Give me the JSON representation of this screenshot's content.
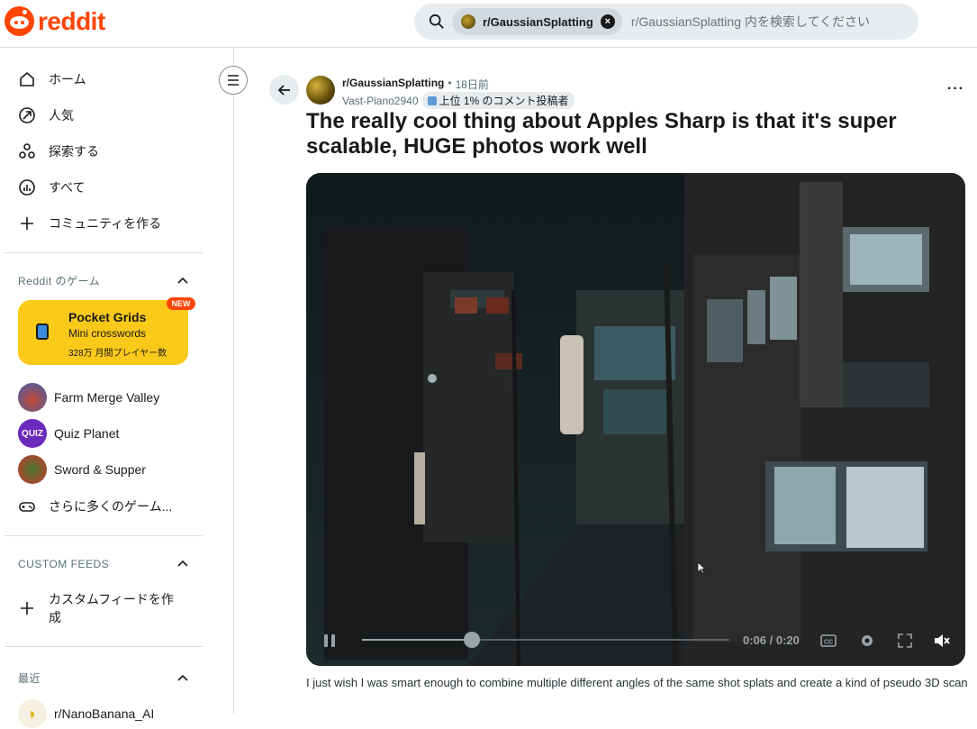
{
  "header": {
    "logo_text": "reddit",
    "search": {
      "chip_label": "r/GaussianSplatting",
      "placeholder": "r/GaussianSplatting 内を検索してください"
    }
  },
  "sidebar": {
    "nav": [
      {
        "label": "ホーム",
        "icon": "home-icon"
      },
      {
        "label": "人気",
        "icon": "popular-icon"
      },
      {
        "label": "探索する",
        "icon": "explore-icon"
      },
      {
        "label": "すべて",
        "icon": "all-icon"
      },
      {
        "label": "コミュニティを作る",
        "icon": "plus-icon"
      }
    ],
    "games_section": {
      "title": "Reddit のゲーム",
      "featured": {
        "title": "Pocket Grids",
        "subtitle": "Mini crosswords",
        "players": "328万 月間プレイヤー数",
        "badge": "NEW"
      },
      "games": [
        {
          "label": "Farm Merge Valley",
          "color": "#3b5fa8"
        },
        {
          "label": "Quiz Planet",
          "color": "#6a2bbd"
        },
        {
          "label": "Sword & Supper",
          "color": "#c8332f"
        }
      ],
      "more_label": "さらに多くのゲーム..."
    },
    "custom_feeds": {
      "title": "CUSTOM FEEDS",
      "create_label": "カスタムフィードを作成"
    },
    "recent": {
      "title": "最近",
      "items": [
        {
          "label": "r/NanoBanana_AI"
        }
      ]
    }
  },
  "post": {
    "subreddit": "r/GaussianSplatting",
    "dot": "•",
    "time": "18日前",
    "author": "Vast-Piano2940",
    "flair": "上位 1% のコメント投稿者",
    "title": "The really cool thing about Apples Sharp is that it's super scalable, HUGE photos work well",
    "video": {
      "time_text": "0:06 / 0:20",
      "progress": 0.3
    },
    "caption": "I just wish I was smart enough to combine multiple different angles of the same shot splats and create a kind of pseudo 3D scan"
  }
}
